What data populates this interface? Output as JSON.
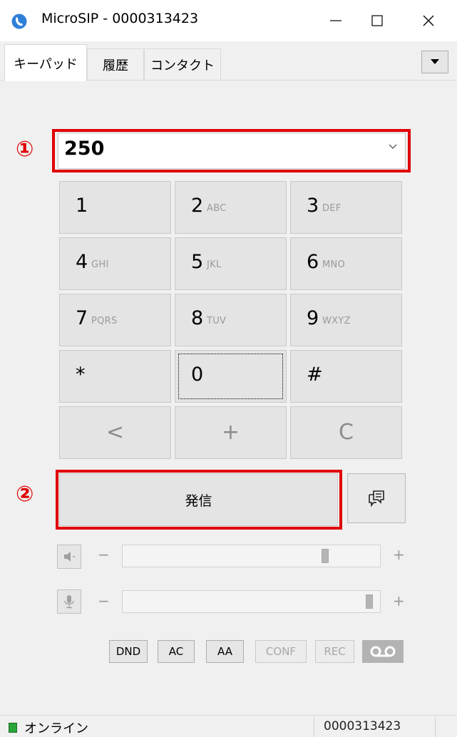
{
  "window": {
    "title": "MicroSIP - 0000313423",
    "minimize_label": "—",
    "maximize_label": "☐",
    "close_label": "✕"
  },
  "tabs": [
    {
      "label": "キーパッド",
      "active": true
    },
    {
      "label": "履歴",
      "active": false
    },
    {
      "label": "コンタクト",
      "active": false
    }
  ],
  "annotations": {
    "marker1": "①",
    "marker2": "②",
    "color": "#e00000"
  },
  "dial": {
    "number": "250"
  },
  "keypad": {
    "keys": [
      {
        "digit": "1",
        "letters": ""
      },
      {
        "digit": "2",
        "letters": "ABC"
      },
      {
        "digit": "3",
        "letters": "DEF"
      },
      {
        "digit": "4",
        "letters": "GHI"
      },
      {
        "digit": "5",
        "letters": "JKL"
      },
      {
        "digit": "6",
        "letters": "MNO"
      },
      {
        "digit": "7",
        "letters": "PQRS"
      },
      {
        "digit": "8",
        "letters": "TUV"
      },
      {
        "digit": "9",
        "letters": "WXYZ"
      },
      {
        "digit": "*",
        "letters": ""
      },
      {
        "digit": "0",
        "letters": ""
      },
      {
        "digit": "#",
        "letters": ""
      }
    ],
    "backspace": "<",
    "plus": "+",
    "clear": "C"
  },
  "call": {
    "label": "発信",
    "message_icon": "message-icon"
  },
  "volume": {
    "speaker": {
      "minus": "−",
      "plus": "+",
      "level": 0.8
    },
    "microphone": {
      "minus": "−",
      "plus": "+",
      "level": 0.98
    }
  },
  "buttons": [
    {
      "label": "DND",
      "enabled": true
    },
    {
      "label": "AC",
      "enabled": true
    },
    {
      "label": "AA",
      "enabled": true
    },
    {
      "label": "CONF",
      "enabled": false
    },
    {
      "label": "REC",
      "enabled": false
    }
  ],
  "voicemail_icon": "voicemail-icon",
  "status": {
    "text": "オンライン",
    "account": "0000313423",
    "color": "#29a63a"
  }
}
